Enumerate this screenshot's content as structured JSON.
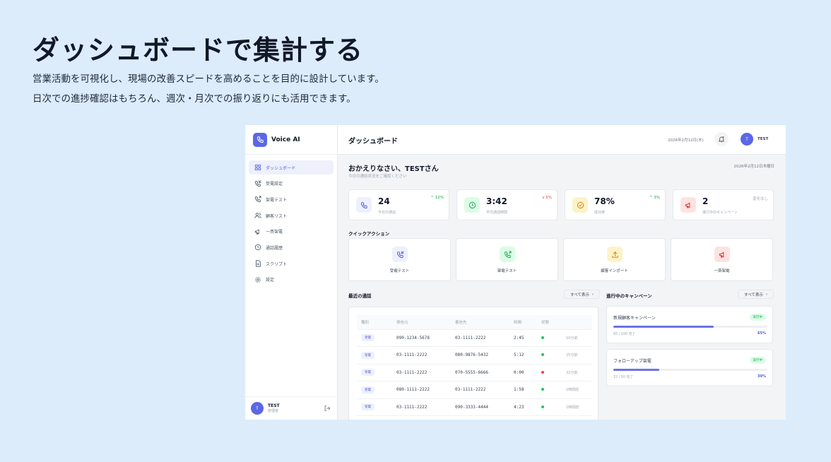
{
  "hero": {
    "title": "ダッシュボードで集計する",
    "desc_line1": "営業活動を可視化し、現場の改善スピードを高めることを目的に設計しています。",
    "desc_line2": "日次での進捗確認はもちろん、週次・月次での振り返りにも活用できます。"
  },
  "app": {
    "brand": "Voice AI",
    "page_title": "ダッシュボード",
    "top_date": "2026年2月12日(木)",
    "user_initial": "T",
    "user_name": "TEST",
    "user_role": "管理者",
    "accent": "#5b67e8"
  },
  "sidebar": {
    "items": [
      {
        "label": "ダッシュボード",
        "icon": "grid-icon"
      },
      {
        "label": "受電設定",
        "icon": "phone-in-icon"
      },
      {
        "label": "架電テスト",
        "icon": "phone-out-icon"
      },
      {
        "label": "顧客リスト",
        "icon": "users-icon"
      },
      {
        "label": "一斉架電",
        "icon": "megaphone-icon"
      },
      {
        "label": "通話履歴",
        "icon": "clock-icon"
      },
      {
        "label": "スクリプト",
        "icon": "document-icon"
      },
      {
        "label": "設定",
        "icon": "gear-icon"
      }
    ]
  },
  "main": {
    "welcome": "おかえりなさい、TESTさん",
    "welcome_sub": "今日の通話状況をご確認ください",
    "date": "2026年2月12日木曜日"
  },
  "stats": [
    {
      "value": "24",
      "label": "今日の通話",
      "trend": "^ 12%",
      "trend_color": "#16a34a",
      "icon": "phone-icon"
    },
    {
      "value": "3:42",
      "label": "平均通話時間",
      "trend": "v 5%",
      "trend_color": "#ef4444",
      "icon": "clock-icon"
    },
    {
      "value": "78%",
      "label": "成功率",
      "trend": "^ 3%",
      "trend_color": "#16a34a",
      "icon": "check-circle-icon"
    },
    {
      "value": "2",
      "label": "進行中のキャンペーン",
      "trend": "変化なし",
      "trend_color": "#9ca3af",
      "icon": "megaphone-icon"
    }
  ],
  "quick_actions": {
    "title": "クイックアクション",
    "items": [
      {
        "label": "受電テスト",
        "icon": "phone-in-icon"
      },
      {
        "label": "架電テスト",
        "icon": "phone-out-icon"
      },
      {
        "label": "顧客インポート",
        "icon": "upload-icon"
      },
      {
        "label": "一斉架電",
        "icon": "megaphone-icon"
      }
    ]
  },
  "recent_calls": {
    "title": "最近の通話",
    "view_all": "すべて表示",
    "headers": [
      "種別",
      "発信元",
      "着信先",
      "時間",
      "状態",
      ""
    ],
    "rows": [
      {
        "type": "受電",
        "from": "090-1234-5678",
        "to": "03-1111-2222",
        "duration": "2:45",
        "status": "success",
        "ago": "10分前"
      },
      {
        "type": "架電",
        "from": "03-1111-2222",
        "to": "080-9876-5432",
        "duration": "5:12",
        "status": "success",
        "ago": "25分前"
      },
      {
        "type": "架電",
        "from": "03-1111-2222",
        "to": "070-5555-6666",
        "duration": "0:00",
        "status": "failed",
        "ago": "32分前"
      },
      {
        "type": "受電",
        "from": "080-1111-2222",
        "to": "03-1111-2222",
        "duration": "1:58",
        "status": "success",
        "ago": "1時間前"
      },
      {
        "type": "架電",
        "from": "03-1111-2222",
        "to": "090-3333-4444",
        "duration": "4:23",
        "status": "success",
        "ago": "1時間前"
      }
    ]
  },
  "campaigns": {
    "title": "進行中のキャンペーン",
    "view_all": "すべて表示",
    "items": [
      {
        "name": "新規顧客キャンペーン",
        "badge": "実行中",
        "progress_text": "65 / 100 完了",
        "percent": 65,
        "percent_text": "65%"
      },
      {
        "name": "フォローアップ架電",
        "badge": "実行中",
        "progress_text": "15 / 50 完了",
        "percent": 30,
        "percent_text": "30%"
      }
    ]
  }
}
